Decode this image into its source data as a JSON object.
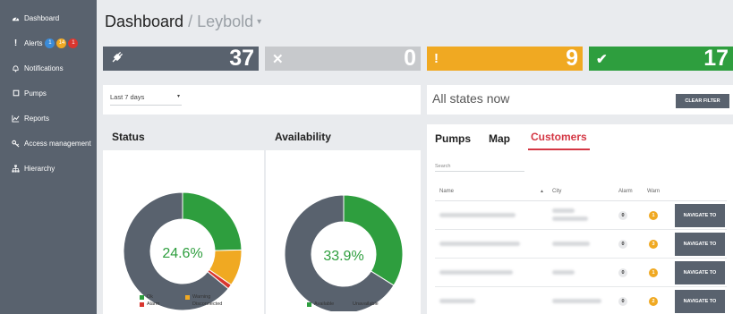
{
  "sidebar": {
    "items": [
      {
        "label": "Dashboard",
        "icon": "dashboard-icon"
      },
      {
        "label": "Alerts",
        "icon": "exclamation-icon",
        "badges": [
          {
            "value": "1",
            "color": "#3b8bd8"
          },
          {
            "value": "14",
            "color": "#f0a922"
          },
          {
            "value": "1",
            "color": "#d9362f"
          }
        ]
      },
      {
        "label": "Notifications",
        "icon": "bell-icon"
      },
      {
        "label": "Pumps",
        "icon": "square-icon"
      },
      {
        "label": "Reports",
        "icon": "chart-line-icon"
      },
      {
        "label": "Access management",
        "icon": "key-icon"
      },
      {
        "label": "Hierarchy",
        "icon": "sitemap-icon"
      }
    ]
  },
  "header": {
    "title": "Dashboard",
    "separator": "/",
    "subtitle": "Leybold",
    "caret": "▾"
  },
  "stats": [
    {
      "value": "37",
      "icon": "plug-icon",
      "glyph": "🔌",
      "color": "#59626e"
    },
    {
      "value": "0",
      "icon": "x-icon",
      "glyph": "✕",
      "color": "#c7c9cc"
    },
    {
      "value": "9",
      "icon": "exclamation-icon",
      "glyph": "!",
      "color": "#f0a922"
    },
    {
      "value": "17",
      "icon": "check-icon",
      "glyph": "✔",
      "color": "#2e9e3e"
    }
  ],
  "filter": {
    "value": "Last 7 days",
    "caret": "▾"
  },
  "states": {
    "title": "All states now",
    "clear_label": "CLEAR FILTER"
  },
  "status_panel": {
    "title": "Status",
    "center_label": "24.6%",
    "legend": [
      {
        "label": "Ok",
        "color": "#2e9e3e"
      },
      {
        "label": "Warning",
        "color": "#f0a922"
      },
      {
        "label": "Alarm",
        "color": "#d9362f"
      },
      {
        "label": "Disconnected",
        "color": "#59626e"
      }
    ]
  },
  "availability_panel": {
    "title": "Availability",
    "center_label": "33.9%",
    "legend": [
      {
        "label": "Available",
        "color": "#2e9e3e"
      },
      {
        "label": "Unavailable",
        "color": "#59626e"
      }
    ]
  },
  "chart_data": [
    {
      "type": "pie",
      "title": "Status",
      "categories": [
        "Ok",
        "Warning",
        "Alarm",
        "Disconnected"
      ],
      "values": [
        24.6,
        10.0,
        1.3,
        64.1
      ],
      "center_label": "24.6%"
    },
    {
      "type": "pie",
      "title": "Availability",
      "categories": [
        "Available",
        "Unavailable"
      ],
      "values": [
        33.9,
        66.1
      ],
      "center_label": "33.9%"
    }
  ],
  "customers_panel": {
    "tabs": [
      {
        "label": "Pumps"
      },
      {
        "label": "Map"
      },
      {
        "label": "Customers",
        "active": true
      }
    ],
    "search_placeholder": "Search",
    "columns": [
      "Name",
      "City",
      "Alarm",
      "Warn"
    ],
    "sort_icon": "▲",
    "rows": [
      {
        "alarm": "0",
        "warn": "1",
        "action": "NAVIGATE TO"
      },
      {
        "alarm": "0",
        "warn": "3",
        "action": "NAVIGATE TO"
      },
      {
        "alarm": "0",
        "warn": "1",
        "action": "NAVIGATE TO"
      },
      {
        "alarm": "0",
        "warn": "2",
        "action": "NAVIGATE TO"
      }
    ]
  }
}
